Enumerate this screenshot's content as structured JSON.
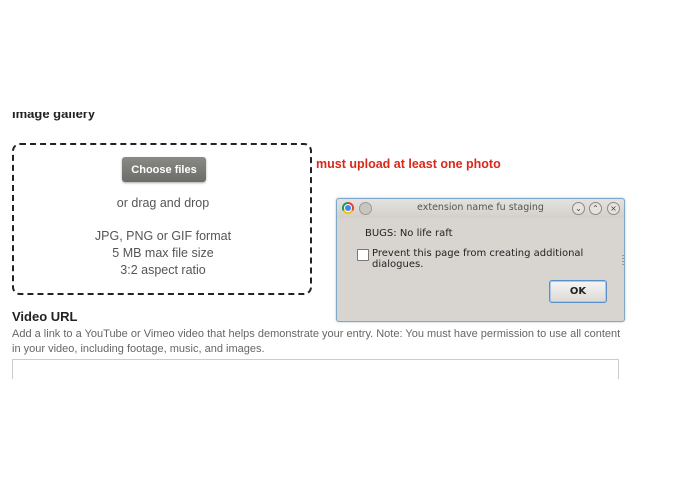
{
  "form": {
    "gallery_heading": "Image gallery",
    "choose_files_label": "Choose files",
    "drag_drop_text": "or drag and drop",
    "format_text": "JPG, PNG or GIF format",
    "size_text": "5 MB max file size",
    "aspect_text": "3:2 aspect ratio",
    "error_text": "must upload at least one photo",
    "video_label": "Video URL",
    "video_help": "Add a link to a YouTube or Vimeo video that helps demonstrate your entry. Note: You must have permission to use all content in your video, including footage, music, and images.",
    "video_value": ""
  },
  "dialog": {
    "title": "extension name fu staging",
    "message": "BUGS: No life raft",
    "checkbox_label": "Prevent this page from creating additional dialogues.",
    "checkbox_checked": false,
    "ok_label": "OK",
    "titlebar_buttons": [
      "chevron-down-icon",
      "chevron-up-icon",
      "close-icon"
    ]
  },
  "colors": {
    "error": "#d9271a",
    "dialog_bg": "#d8d5d1",
    "dialog_border": "#7fa9cb",
    "button_gray": "#7b7b77"
  }
}
